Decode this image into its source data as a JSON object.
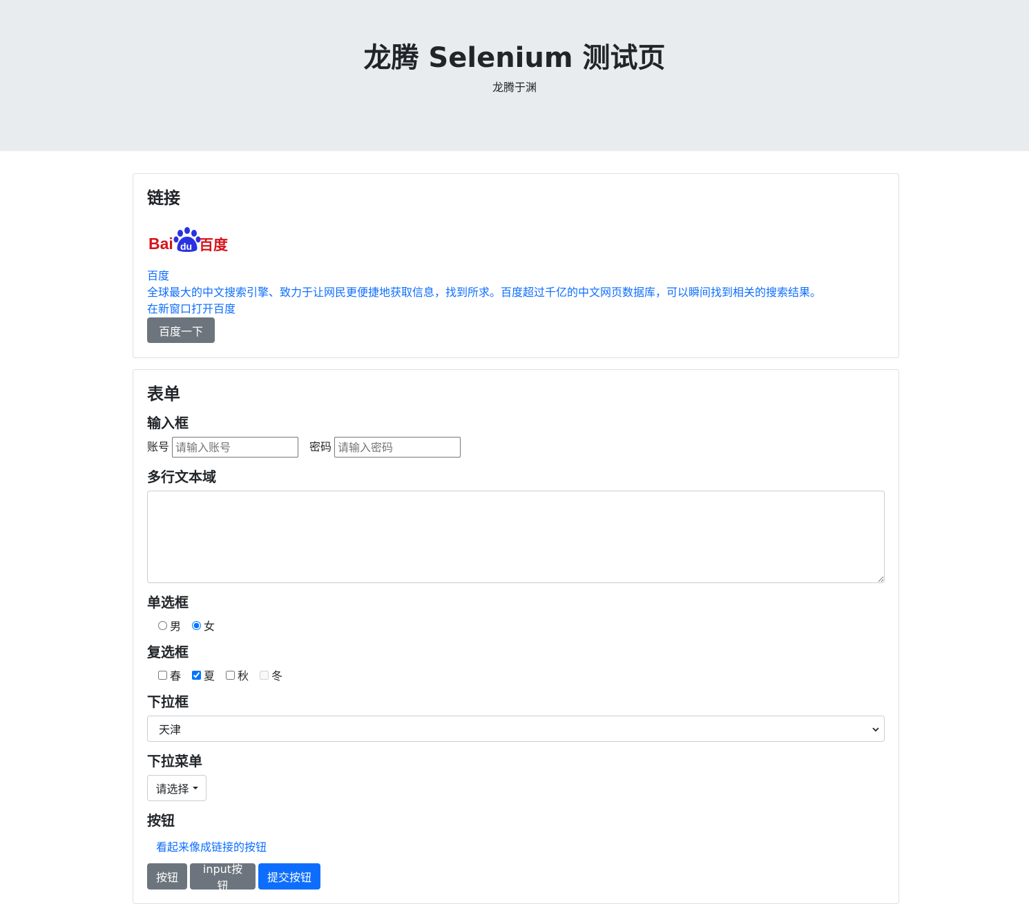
{
  "header": {
    "title": "龙腾 Selenium 测试页",
    "subtitle": "龙腾于渊"
  },
  "links": {
    "heading": "链接",
    "logo": {
      "text_bai": "Bai",
      "text_du": "du",
      "text_cn": "百度",
      "red": "#d7121b",
      "blue": "#2932e1"
    },
    "baidu_link": "百度",
    "description_link": "全球最大的中文搜索引擎、致力于让网民更便捷地获取信息，找到所求。百度超过千亿的中文网页数据库，可以瞬间找到相关的搜索结果。",
    "new_window_link": "在新窗口打开百度",
    "search_button": "百度一下"
  },
  "form": {
    "heading": "表单",
    "inputs_title": "输入框",
    "account_label": "账号",
    "account_placeholder": "请输入账号",
    "password_label": "密码",
    "password_placeholder": "请输入密码",
    "textarea_title": "多行文本域",
    "radio_title": "单选框",
    "radios": [
      {
        "label": "男",
        "checked": false
      },
      {
        "label": "女",
        "checked": true
      }
    ],
    "checkbox_title": "复选框",
    "checkboxes": [
      {
        "label": "春",
        "checked": false,
        "disabled": false
      },
      {
        "label": "夏",
        "checked": true,
        "disabled": false
      },
      {
        "label": "秋",
        "checked": false,
        "disabled": false
      },
      {
        "label": "冬",
        "checked": false,
        "disabled": true
      }
    ],
    "select_title": "下拉框",
    "select_value": "天津",
    "dropdown_title": "下拉菜单",
    "dropdown_label": "请选择",
    "buttons_title": "按钮",
    "link_button": "看起来像成链接的按钮",
    "button_label": "按钮",
    "input_button_label": "input按钮",
    "submit_button_label": "提交按钮"
  },
  "colors": {
    "primary": "#0d6efd",
    "secondary": "#6c757d",
    "header_bg": "#e9ecef"
  }
}
